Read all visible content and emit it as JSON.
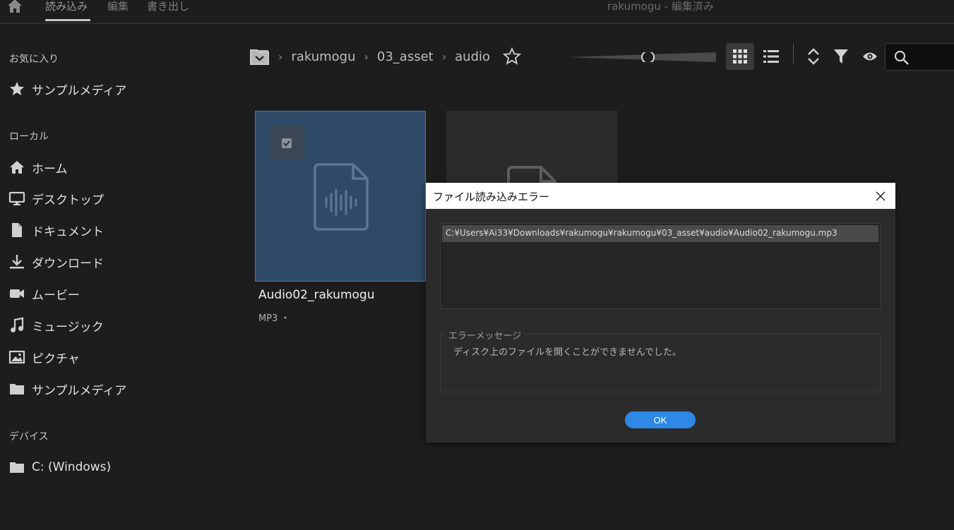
{
  "topbar": {
    "tabs": [
      "読み込み",
      "編集",
      "書き出し"
    ],
    "title": "rakumogu - 編集済み"
  },
  "sidebar": {
    "favorites_header": "お気に入り",
    "favorites": [
      {
        "label": "サンプルメディア",
        "icon": "star-icon"
      }
    ],
    "local_header": "ローカル",
    "local": [
      {
        "label": "ホーム",
        "icon": "home-icon"
      },
      {
        "label": "デスクトップ",
        "icon": "monitor-icon"
      },
      {
        "label": "ドキュメント",
        "icon": "document-icon"
      },
      {
        "label": "ダウンロード",
        "icon": "download-icon"
      },
      {
        "label": "ムービー",
        "icon": "video-camera-icon"
      },
      {
        "label": "ミュージック",
        "icon": "music-note-icon"
      },
      {
        "label": "ピクチャ",
        "icon": "picture-icon"
      },
      {
        "label": "サンプルメディア",
        "icon": "folder-icon"
      }
    ],
    "devices_header": "デバイス",
    "devices": [
      {
        "label": "C: (Windows)",
        "icon": "folder-icon"
      }
    ]
  },
  "breadcrumb": [
    "rakumogu",
    "03_asset",
    "audio"
  ],
  "toolbar": {
    "thumbnail_size": 0.55,
    "view_mode": "grid"
  },
  "files": [
    {
      "name": "Audio02_rakumogu",
      "meta": "MP3 ・",
      "selected": true
    }
  ],
  "dialog": {
    "title": "ファイル読み込みエラー",
    "paths": [
      "C:¥Users¥Ai33¥Downloads¥rakumogu¥rakumogu¥03_asset¥audio¥Audio02_rakumogu.mp3"
    ],
    "message_label": "エラーメッセージ",
    "message": "ディスク上のファイルを開くことができませんでした。",
    "ok_label": "OK"
  },
  "colors": {
    "background": "#1d1d1d",
    "selected_card": "#2f4a66",
    "accent_button": "#2d88e6"
  }
}
